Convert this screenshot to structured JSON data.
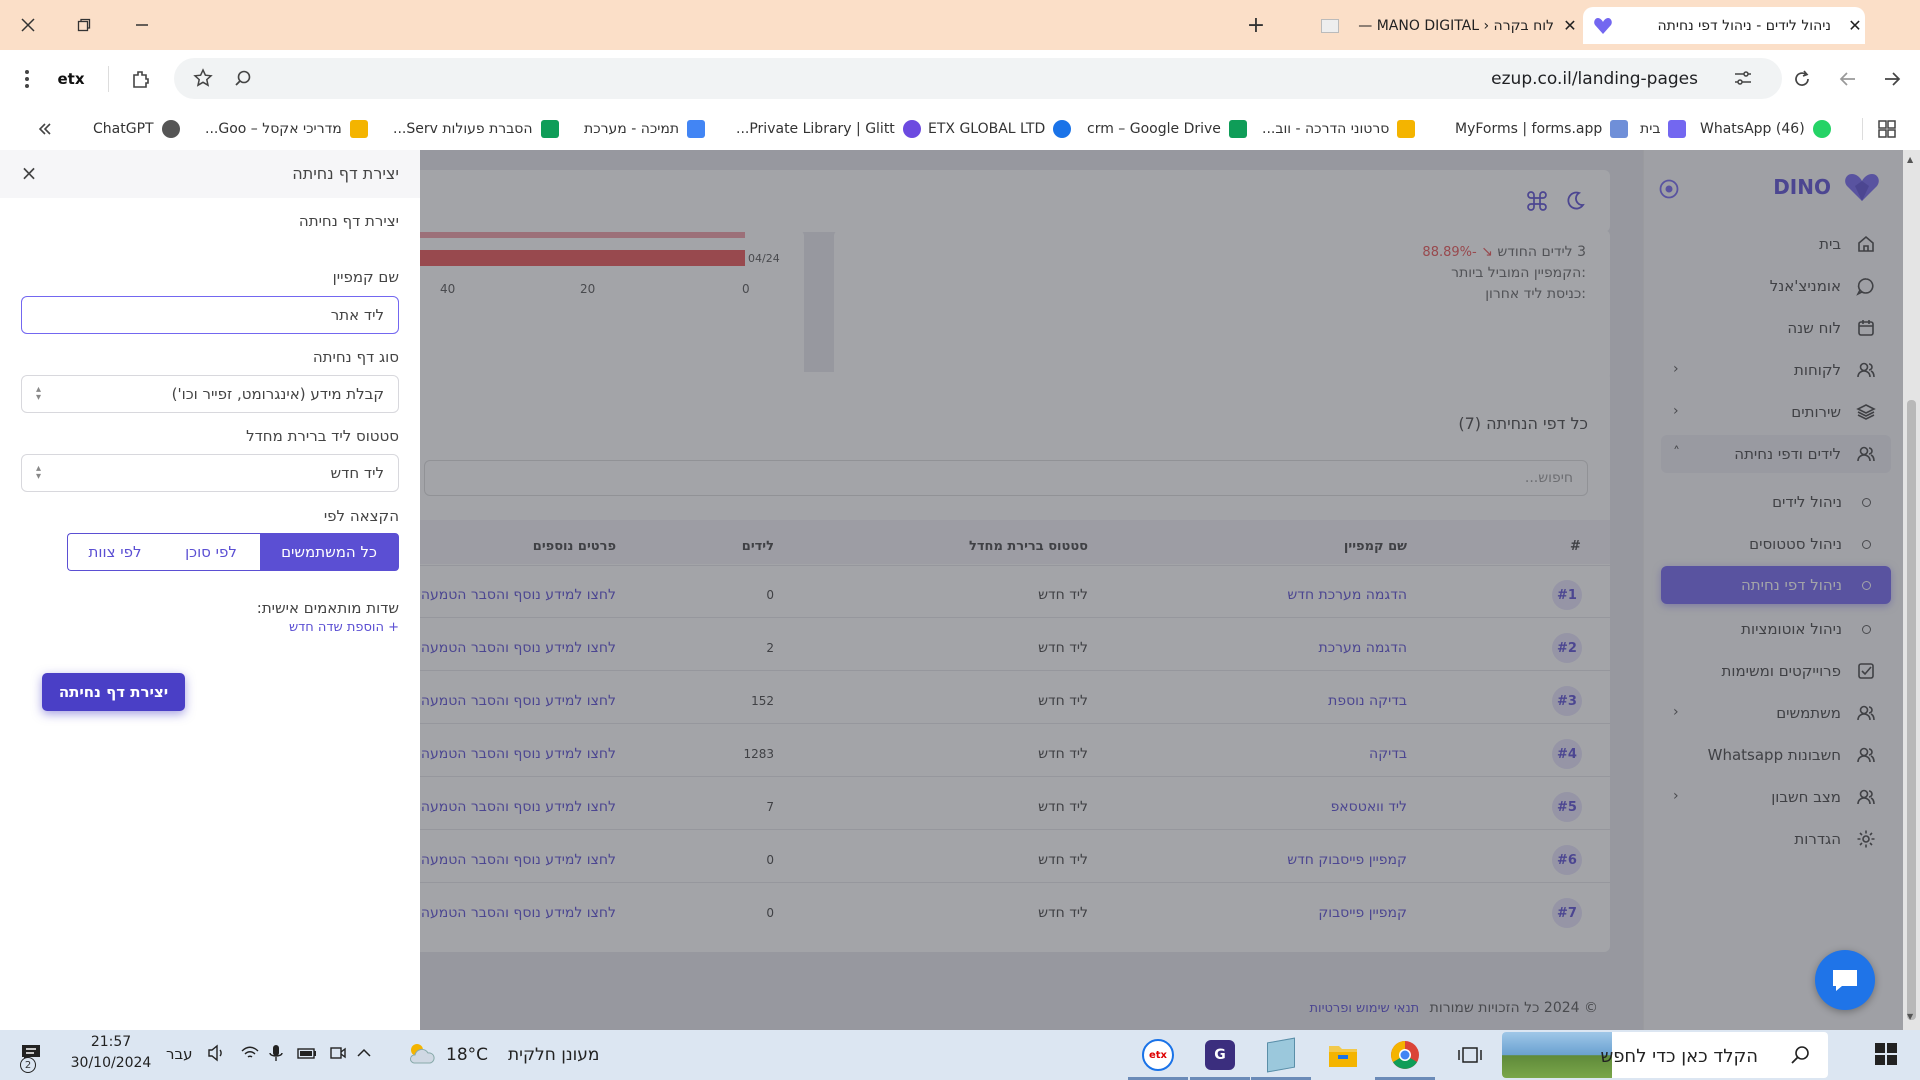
{
  "browser": {
    "tabs": [
      {
        "title": "ניהול לידים - ניהול דפי נחיתה",
        "active": true
      },
      {
        "title": "לוח בקרה ‹ MANO DIGITAL —",
        "active": false
      }
    ],
    "url": "ezup.co.il/landing-pages",
    "bookmarks": [
      {
        "label": "(46) WhatsApp",
        "color": "#25d366"
      },
      {
        "label": "בית",
        "color": "#7367f0"
      },
      {
        "label": "MyForms | forms.app",
        "color": "#6f8fd8"
      },
      {
        "label": "סרטוני הדרכה - ווב...",
        "color": "#f4b400"
      },
      {
        "label": "crm – Google Drive",
        "color": "#0f9d58"
      },
      {
        "label": "ETX GLOBAL LTD",
        "color": "#1a73e8"
      },
      {
        "label": "Private Library | Glitt...",
        "color": "#6c4ae0"
      },
      {
        "label": "תמיכה - מערכת",
        "color": "#4285f4"
      },
      {
        "label": "הסברת פעולות Serv...",
        "color": "#0f9d58"
      },
      {
        "label": "מדריכי אקסל – Goo...",
        "color": "#f4b400"
      },
      {
        "label": "ChatGPT",
        "color": "#555555"
      }
    ]
  },
  "sidebar": {
    "brand": "DINO",
    "items": [
      {
        "label": "בית",
        "icon": "home-icon"
      },
      {
        "label": "אומניצ'אנל",
        "icon": "chat-icon"
      },
      {
        "label": "לוח שנה",
        "icon": "calendar-icon"
      },
      {
        "label": "לקוחות",
        "icon": "users-icon",
        "chevron": "left"
      },
      {
        "label": "שירותים",
        "icon": "layers-icon",
        "chevron": "left"
      },
      {
        "label": "לידים ודפי נחיתה",
        "icon": "users-icon",
        "chevron": "up"
      },
      {
        "label": "ניהול לידים",
        "sub": true
      },
      {
        "label": "ניהול סטטוסים",
        "sub": true
      },
      {
        "label": "ניהול דפי נחיתה",
        "sub": true,
        "active": true
      },
      {
        "label": "ניהול אוטומציות",
        "sub": true
      },
      {
        "label": "פרוייקטים ומשימות",
        "icon": "checkbox-icon"
      },
      {
        "label": "משתמשים",
        "icon": "users-icon",
        "chevron": "left"
      },
      {
        "label": "חשבונות Whatsapp",
        "icon": "users-icon"
      },
      {
        "label": "מצב חשבון",
        "icon": "users-icon",
        "chevron": "left"
      },
      {
        "label": "הגדרות",
        "icon": "gear-icon"
      }
    ]
  },
  "stats": {
    "new_leads": "3 לידים החודש",
    "change": "-88.89%",
    "top_campaign": "הקמפיין המוביל ביותר:",
    "last_lead": "כניסת ליד אחרון:",
    "bar_date": "04/24",
    "axis_ticks": [
      "0",
      "20",
      "40"
    ]
  },
  "table": {
    "title": "כל דפי הנחיתה (7)",
    "search_placeholder": "חיפוש...",
    "headers": {
      "index": "#",
      "campaign": "שם קמפיין",
      "status": "סטטוס ברירת מחדל",
      "leads": "לידים",
      "details": "פרטים נוספים"
    },
    "rows": [
      {
        "index": "#1",
        "campaign": "הדגמה מערכת חדש",
        "status": "ליד חדש",
        "leads": "0",
        "details": "לחצו למידע נוסף והסבר הטמעה"
      },
      {
        "index": "#2",
        "campaign": "הדגמה מערכת",
        "status": "ליד חדש",
        "leads": "2",
        "details": "לחצו למידע נוסף והסבר הטמעה"
      },
      {
        "index": "#3",
        "campaign": "בדיקה נוספת",
        "status": "ליד חדש",
        "leads": "152",
        "details": "לחצו למידע נוסף והסבר הטמעה"
      },
      {
        "index": "#4",
        "campaign": "בדיקה",
        "status": "ליד חדש",
        "leads": "1283",
        "details": "לחצו למידע נוסף והסבר הטמעה"
      },
      {
        "index": "#5",
        "campaign": "ליד וואטסאפ",
        "status": "ליד חדש",
        "leads": "7",
        "details": "לחצו למידע נוסף והסבר הטמעה"
      },
      {
        "index": "#6",
        "campaign": "קמפיין פייסבוק חדש",
        "status": "ליד חדש",
        "leads": "0",
        "details": "לחצו למידע נוסף והסבר הטמעה"
      },
      {
        "index": "#7",
        "campaign": "קמפיין פייסבוק",
        "status": "ליד חדש",
        "leads": "0",
        "details": "לחצו למידע נוסף והסבר הטמעה"
      }
    ]
  },
  "footer": {
    "copyright": "© 2024 כל הזכויות שמורות",
    "terms": "תנאי שימוש ופרטיות"
  },
  "drawer": {
    "header_title": "יצירת דף נחיתה",
    "subtitle": "יצירת דף נחיתה",
    "campaign_label": "שם קמפיין",
    "campaign_value": "ליד אתר",
    "type_label": "סוג דף נחיתה",
    "type_value": "קבלת מידע (אינגרומט, זפייר וכו')",
    "status_label": "סטטוס ליד ברירת מחדל",
    "status_value": "ליד חדש",
    "assign_label": "הקצאה לפי",
    "assign_options": [
      "כל המשתמשים",
      "לפי סוכן",
      "לפי צוות"
    ],
    "assign_selected": "כל המשתמשים",
    "custom_fields_label": "שדות מותאמים אישית:",
    "add_field": "+ הוספת שדה חדש",
    "submit": "יצירת דף נחיתה"
  },
  "taskbar": {
    "search_placeholder": "הקלד כאן כדי לחפש",
    "weather": "מעונן חלקית",
    "temperature": "18°C",
    "language": "עבר",
    "time": "21:57",
    "date": "30/10/2024",
    "notifications": "2"
  },
  "colors": {
    "accent": "#7367f0",
    "link": "#5b4fd3",
    "overlay": "rgba(60,62,70,0.47)"
  }
}
